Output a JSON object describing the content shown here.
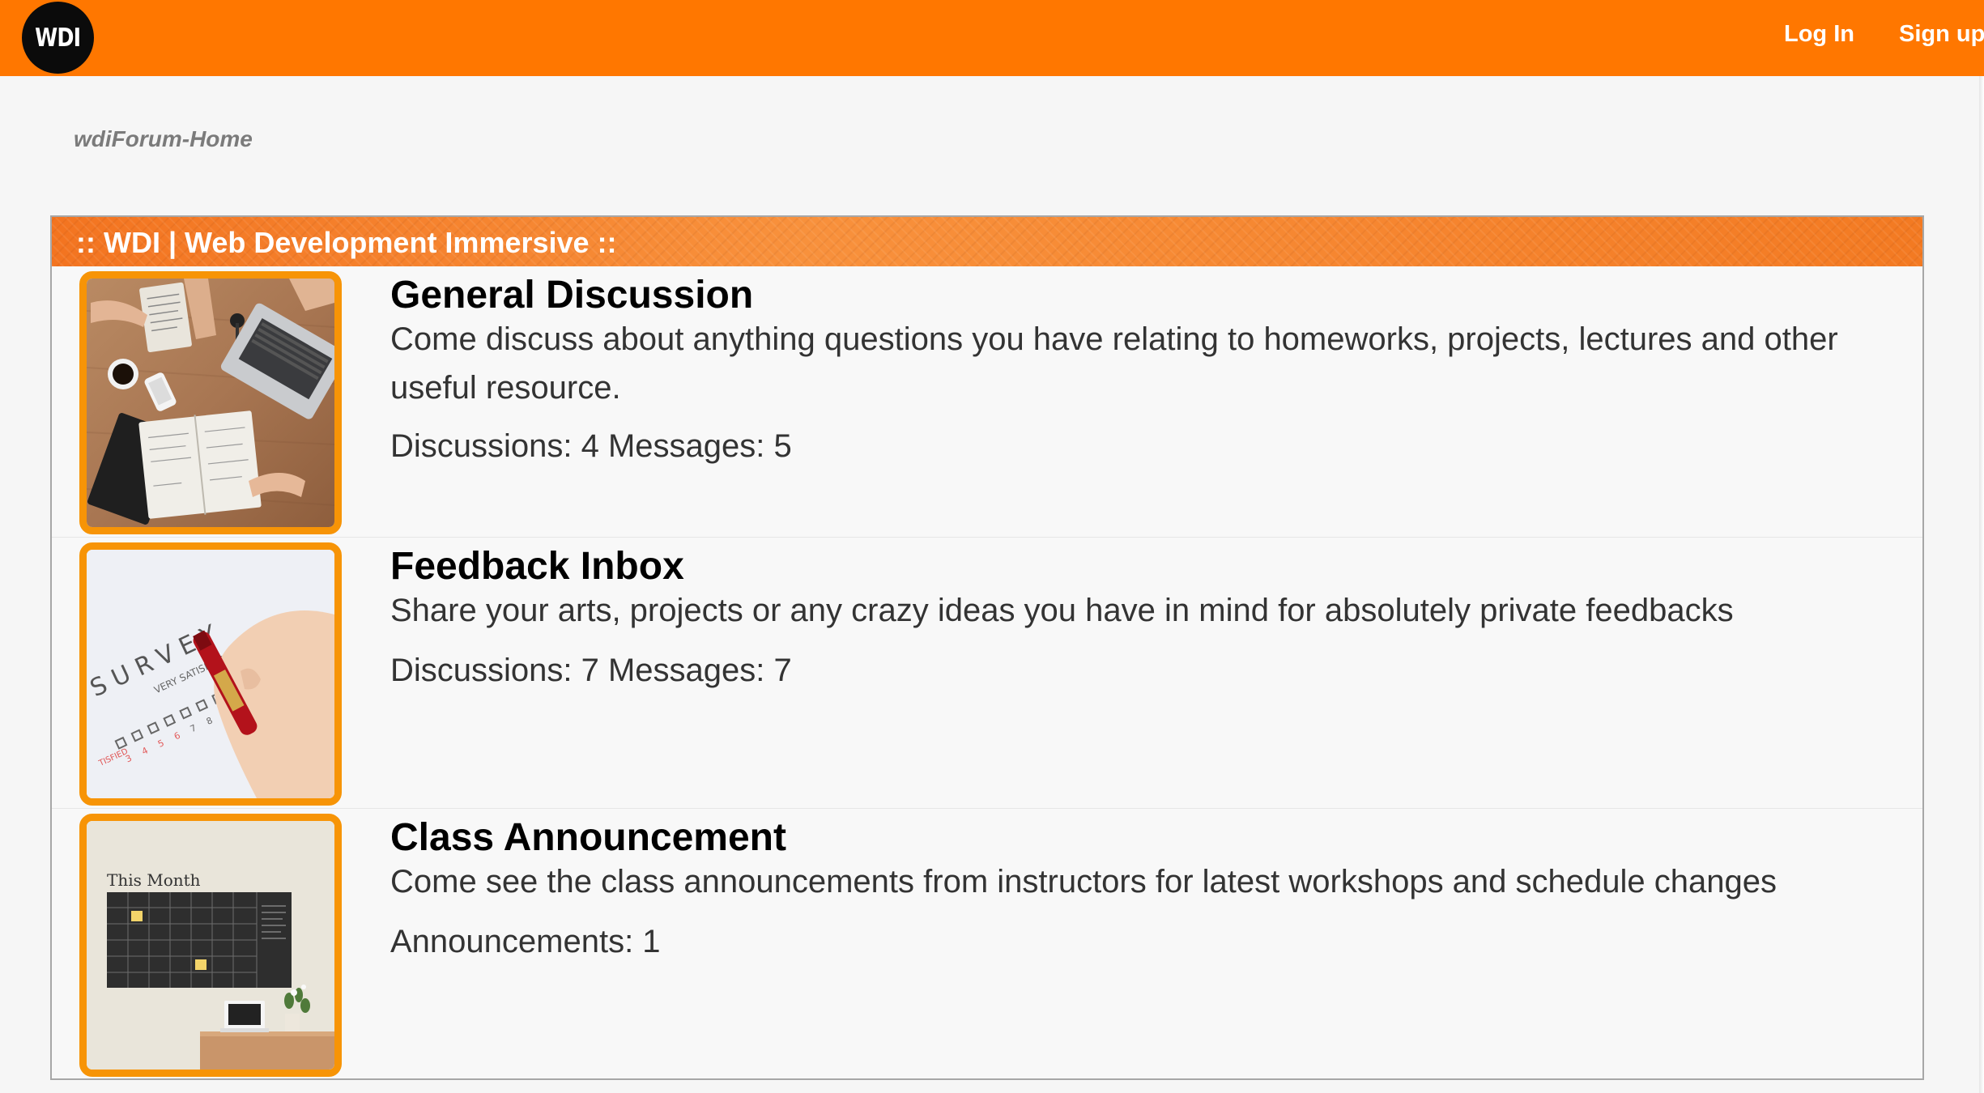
{
  "navbar": {
    "logo_text": "WDI",
    "login_label": "Log In",
    "signup_label": "Sign up"
  },
  "breadcrumb": "wdiForum-Home",
  "forum": {
    "header_title": ":: WDI | Web Development Immersive ::",
    "sections": [
      {
        "title": "General Discussion",
        "description": "Come discuss about anything questions you have relating to homeworks, projects, lectures and other useful resource.",
        "stats": "Discussions: 4 Messages: 5",
        "image_icon": "desk-workspace-photo"
      },
      {
        "title": "Feedback Inbox",
        "description": "Share your arts, projects or any crazy ideas you have in mind for absolutely private feedbacks",
        "stats": "Discussions: 7 Messages: 7",
        "image_icon": "survey-photo"
      },
      {
        "title": "Class Announcement",
        "description": "Come see the class announcements from instructors for latest workshops and schedule changes",
        "stats": "Announcements: 1",
        "image_icon": "calendar-wall-photo"
      }
    ]
  },
  "images": {
    "survey_word": "SURVEY",
    "survey_satisfied": "VERY SATISFIED",
    "survey_dissatisfied": "TISFIED",
    "calendar_heading": "This Month"
  },
  "colors": {
    "brand_orange": "#ff7700",
    "thumb_border": "#f79406",
    "logo_bg": "#0b0b0b"
  }
}
